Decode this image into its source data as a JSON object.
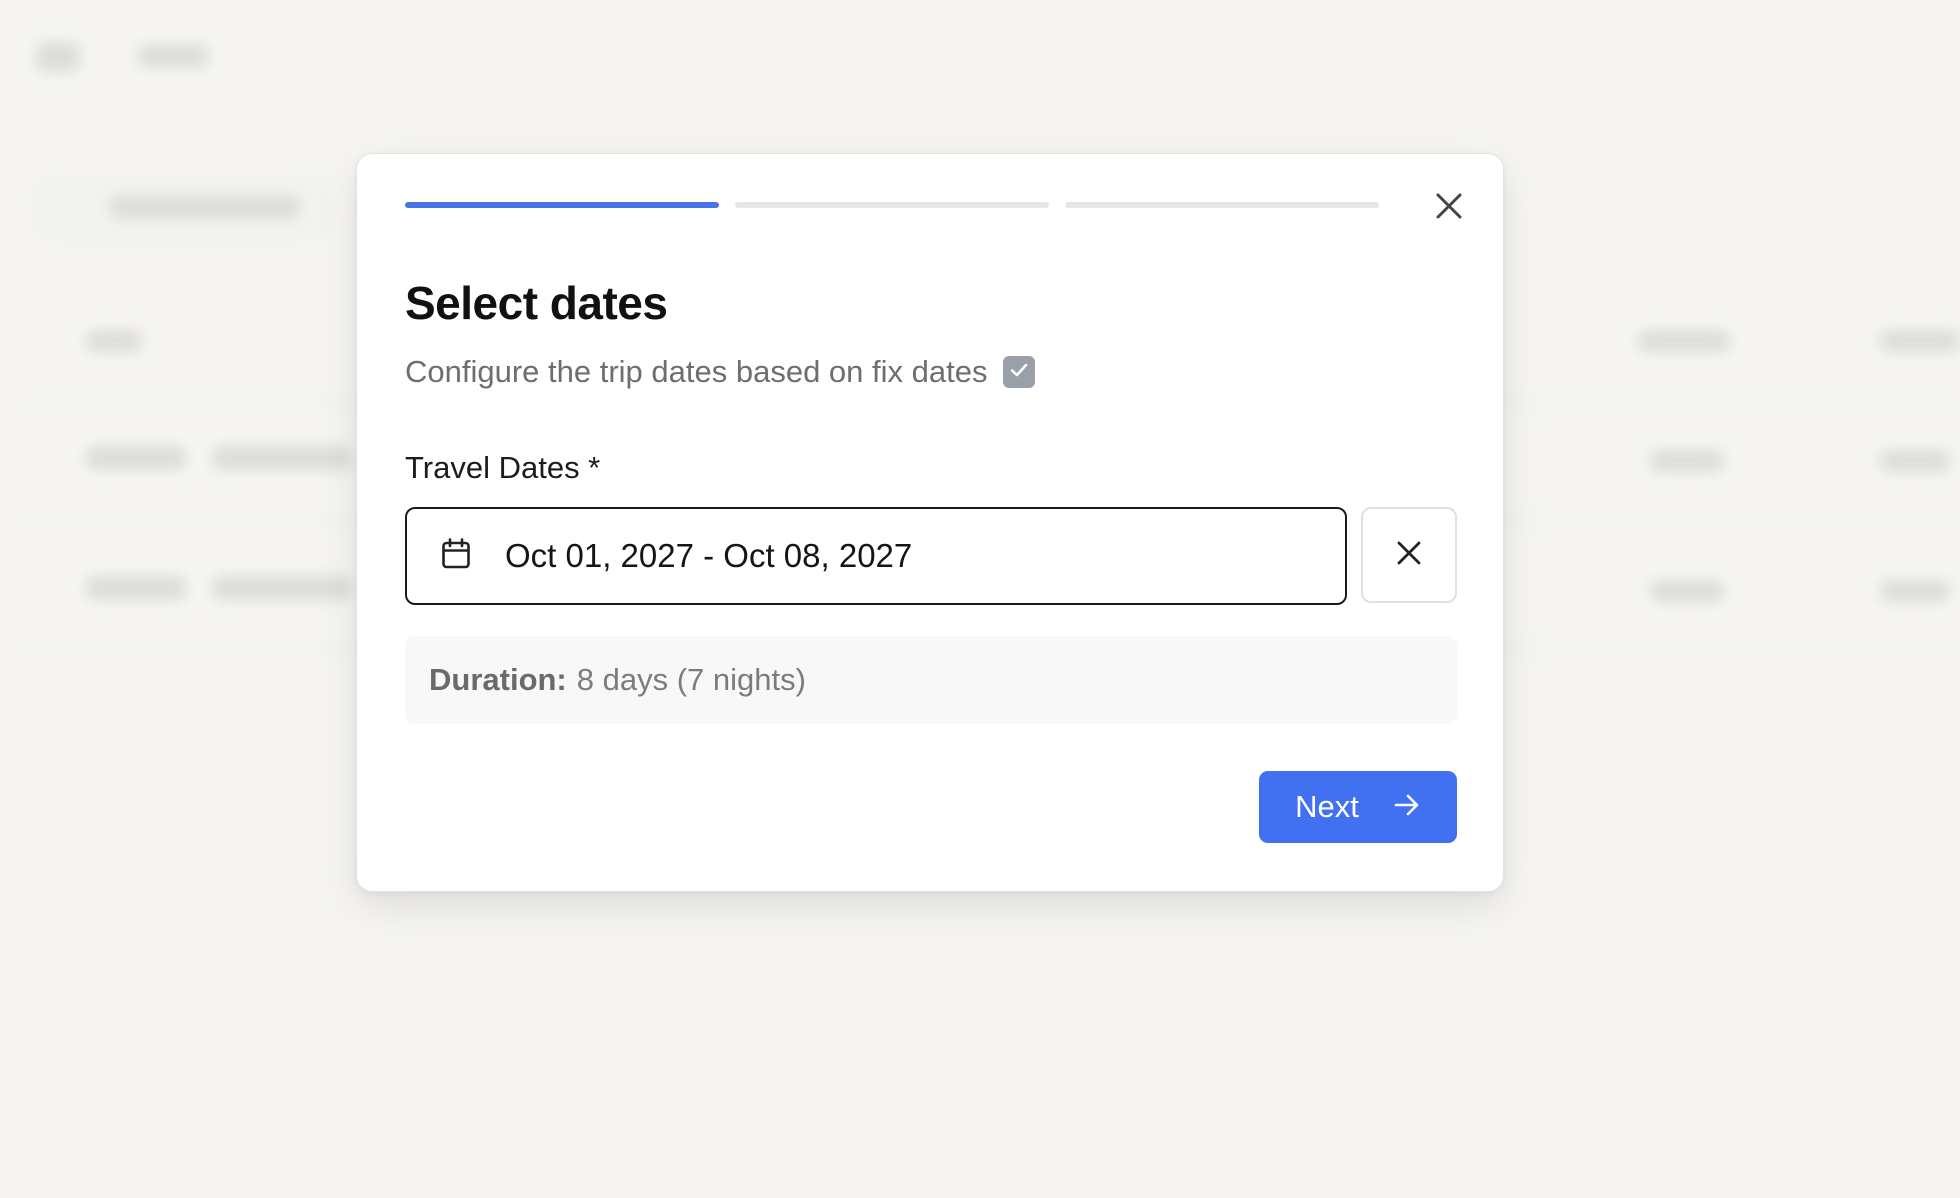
{
  "dialog": {
    "title": "Select dates",
    "subtitle": "Configure the trip dates based on fix dates",
    "fixed_dates_checked": true,
    "progress": {
      "total_steps": 3,
      "current_step": 1
    },
    "travel_dates": {
      "label": "Travel Dates *",
      "value": "Oct 01, 2027 - Oct 08, 2027"
    },
    "duration": {
      "label": "Duration:",
      "value": "8 days (7 nights)"
    },
    "next_label": "Next"
  },
  "icons": {
    "close": "close-icon",
    "calendar": "calendar-icon",
    "clear": "clear-icon",
    "check": "check-icon",
    "arrow": "arrow-right-icon"
  },
  "colors": {
    "accent": "#4170f0",
    "progress_active": "#4a72e8",
    "progress_inactive": "#e6e6e6",
    "checkbox": "#9aa0aa",
    "backdrop": "#f6f5f2"
  }
}
